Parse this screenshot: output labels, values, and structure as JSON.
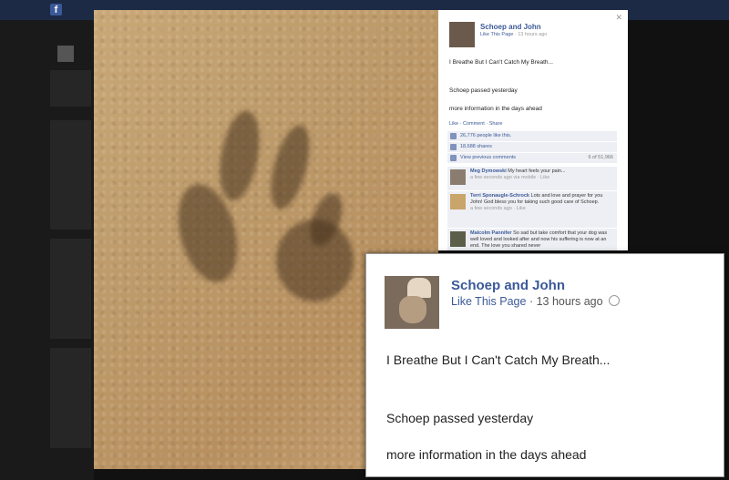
{
  "page": {
    "name": "Schoep and John",
    "like_link": "Like This Page",
    "time": "13 hours ago"
  },
  "post": {
    "line1": "I Breathe But I Can't Catch My Breath...",
    "line2": "Schoep passed yesterday",
    "line3": "more information in the days ahead"
  },
  "actions": "Like · Comment · Share",
  "likes_text": "26,776 people like this.",
  "shares_text": "18,688 shares",
  "view_previous": "View previous comments",
  "comment_count": "6 of 51,966",
  "comments": [
    {
      "author": "Meg Dymowski",
      "text": "My heart feels your pain...",
      "meta": "a few seconds ago via mobile · Like"
    },
    {
      "author": "Terri Sponaugle-Schrock",
      "text": "Lots and love and prayer for you John! God bless you for taking such good care of Schoep.",
      "meta": "a few seconds ago · Like"
    },
    {
      "author": "Malcolm Pannifer",
      "text": "So sad but take comfort that your dog was well loved and looked after and now his suffering is now at an end. The love you shared never",
      "meta": ""
    }
  ],
  "icons": [
    "facebook-logo-icon",
    "close-icon",
    "like-thumb-icon",
    "share-icon",
    "comment-icon",
    "globe-icon"
  ],
  "colors": {
    "link": "#3b5998",
    "comment_bg": "#edeff4",
    "topbar": "#1d2a45"
  }
}
